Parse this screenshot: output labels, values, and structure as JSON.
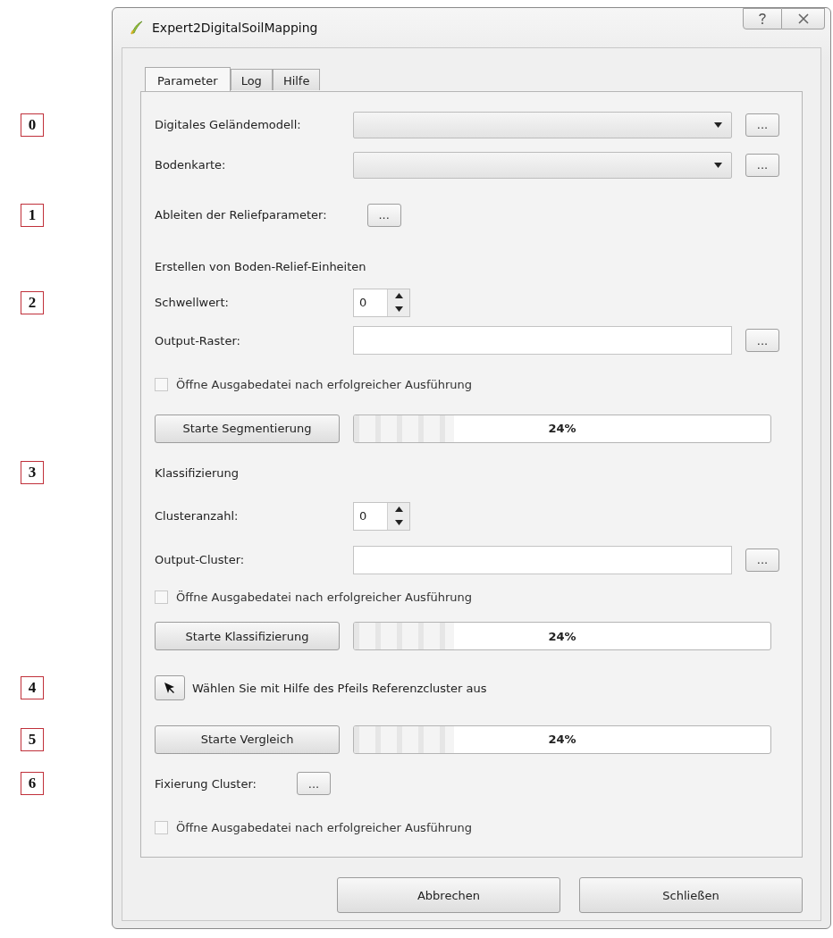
{
  "window": {
    "title": "Expert2DigitalSoilMapping"
  },
  "tabs": [
    {
      "label": "Parameter",
      "selected": true
    },
    {
      "label": "Log",
      "selected": false
    },
    {
      "label": "Hilfe",
      "selected": false
    }
  ],
  "rows": [
    {
      "kind": "combo",
      "label": "Digitales Geländemodell:",
      "button": "...",
      "marker": "0"
    },
    {
      "kind": "combo",
      "label": "Bodenkarte:",
      "button": "..."
    },
    {
      "kind": "tool",
      "label": "Ableiten der Reliefparameter:",
      "button": "...",
      "marker": "1"
    },
    {
      "kind": "heading",
      "label": "Erstellen von Boden-Relief-Einheiten"
    },
    {
      "kind": "spin",
      "label": "Schwellwert:",
      "value": "0",
      "marker": "2"
    },
    {
      "kind": "file",
      "label": "Output-Raster:",
      "button": "..."
    },
    {
      "kind": "checkbox",
      "label": "Öffne Ausgabedatei nach erfolgreicher Ausführung",
      "checked": false
    },
    {
      "kind": "run",
      "button": "Starte Segmentierung",
      "level": 0.24,
      "reading": "24%"
    },
    {
      "kind": "heading",
      "label": "Klassifizierung",
      "marker": "3"
    },
    {
      "kind": "spin",
      "label": "Clusteranzahl:",
      "value": "0"
    },
    {
      "kind": "file",
      "label": "Output-Cluster:",
      "button": "..."
    },
    {
      "kind": "checkbox",
      "label": "Öffne Ausgabedatei nach erfolgreicher Ausführung",
      "checked": false
    },
    {
      "kind": "run",
      "button": "Starte Klassifizierung",
      "level": 0.24,
      "reading": "24%"
    },
    {
      "kind": "pick",
      "label": "Wählen Sie mit Hilfe des Pfeils Referenzcluster aus",
      "marker": "4"
    },
    {
      "kind": "run",
      "button": "Starte Vergleich",
      "level": 0.24,
      "reading": "24%",
      "marker": "5"
    },
    {
      "kind": "tool",
      "label": "Fixierung Cluster:",
      "button": "...",
      "marker": "6"
    },
    {
      "kind": "checkbox",
      "label": "Öffne Ausgabedatei nach erfolgreicher Ausführung",
      "checked": false
    }
  ],
  "buttons": [
    "Abbrechen",
    "Schließen"
  ]
}
